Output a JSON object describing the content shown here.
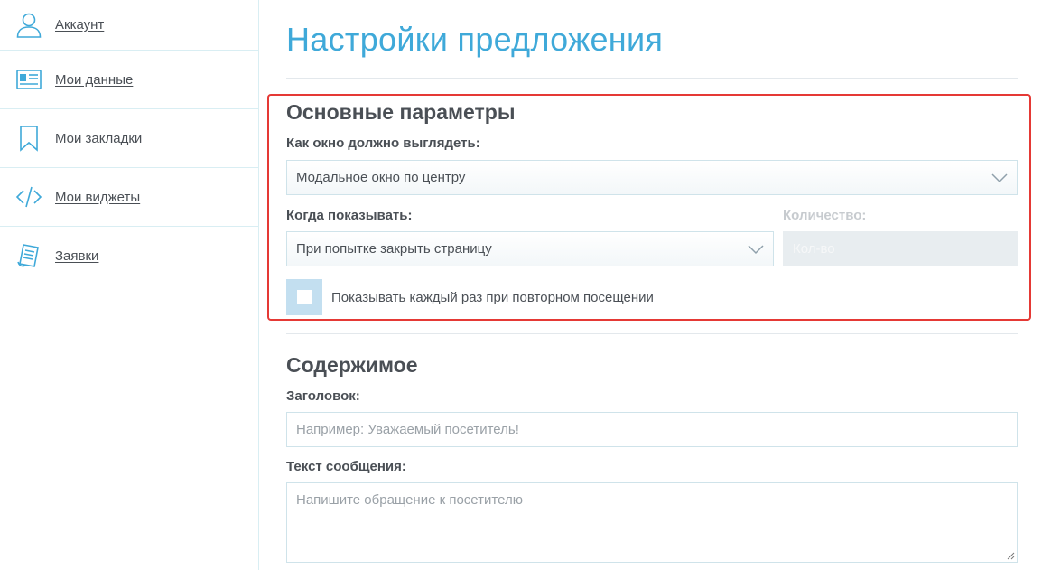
{
  "sidebar": {
    "items": [
      {
        "label": "Аккаунт",
        "icon": "user-icon"
      },
      {
        "label": "Мои данные",
        "icon": "id-card-icon"
      },
      {
        "label": "Мои закладки",
        "icon": "bookmark-icon"
      },
      {
        "label": "Мои виджеты",
        "icon": "code-icon"
      },
      {
        "label": "Заявки",
        "icon": "document-icon"
      }
    ]
  },
  "page": {
    "title": "Настройки предложения"
  },
  "basic": {
    "title": "Основные параметры",
    "appearance_label": "Как окно должно выглядеть:",
    "appearance_value": "Модальное окно по центру",
    "when_label": "Когда показывать:",
    "when_value": "При попытке закрыть страницу",
    "count_label": "Количество:",
    "count_placeholder": "Кол-во",
    "repeat_label": "Показывать каждый раз при повторном посещении"
  },
  "content": {
    "title": "Содержимое",
    "heading_label": "Заголовок:",
    "heading_placeholder": "Например: Уважаемый посетитель!",
    "message_label": "Текст сообщения:",
    "message_placeholder": "Напишите обращение к посетителю"
  },
  "colors": {
    "accent": "#3fa9d9",
    "highlight": "#e53935",
    "checkbox": "#c3dff0"
  }
}
